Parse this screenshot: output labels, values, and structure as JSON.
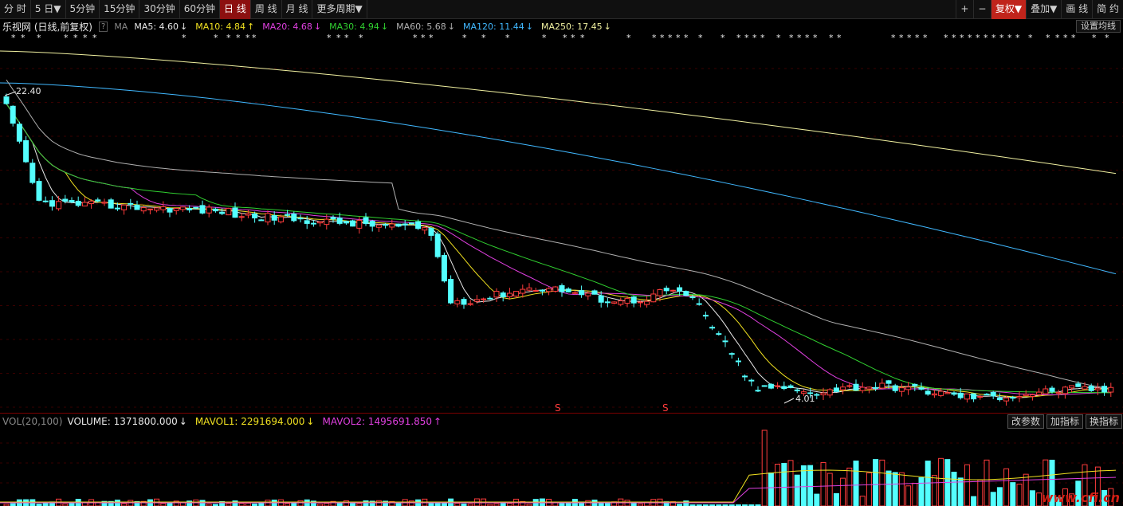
{
  "toolbar": {
    "periods": [
      {
        "label": "分 时",
        "active": false
      },
      {
        "label": "5 日▼",
        "active": false
      },
      {
        "label": "5分钟",
        "active": false
      },
      {
        "label": "15分钟",
        "active": false
      },
      {
        "label": "30分钟",
        "active": false
      },
      {
        "label": "60分钟",
        "active": false
      },
      {
        "label": "日 线",
        "active": true
      },
      {
        "label": "周 线",
        "active": false
      },
      {
        "label": "月 线",
        "active": false
      },
      {
        "label": "更多周期▼",
        "active": false
      }
    ],
    "right": [
      {
        "label": "+",
        "accent": false,
        "sq": true
      },
      {
        "label": "−",
        "accent": false,
        "sq": true
      },
      {
        "label": "复权▼",
        "accent": true,
        "sq": false
      },
      {
        "label": "叠加▼",
        "accent": false,
        "sq": false
      },
      {
        "label": "画 线",
        "accent": false,
        "sq": false
      },
      {
        "label": "简 约",
        "accent": false,
        "sq": false
      }
    ]
  },
  "legend": {
    "stock": "乐视网 (日线,前复权)",
    "question": "?",
    "ma_label": "MA",
    "items": [
      {
        "text": "MA5: 4.60",
        "arrow": "↓",
        "color": "#e8e8e8"
      },
      {
        "text": "MA10: 4.84",
        "arrow": "↑",
        "color": "#f0e020"
      },
      {
        "text": "MA20: 4.68",
        "arrow": "↓",
        "color": "#e040e0"
      },
      {
        "text": "MA30: 4.94",
        "arrow": "↓",
        "color": "#30d030"
      },
      {
        "text": "MA60: 5.68",
        "arrow": "↓",
        "color": "#b0b0b0"
      },
      {
        "text": "MA120: 11.44",
        "arrow": "↓",
        "color": "#40b8ff"
      },
      {
        "text": "MA250: 17.45",
        "arrow": "↓",
        "color": "#f0f0a0"
      }
    ],
    "set_ma": "设置均线"
  },
  "chart_annotations": {
    "high_label": "22.40",
    "low_label": "4.01",
    "s_marker": "S"
  },
  "volume": {
    "name": "VOL(20,100)",
    "items": [
      {
        "text": "VOLUME: 1371800.000",
        "arrow": "↓",
        "color": "#e8e8e8"
      },
      {
        "text": "MAVOL1: 2291694.000",
        "arrow": "↓",
        "color": "#f0e020"
      },
      {
        "text": "MAVOL2: 1495691.850",
        "arrow": "↑",
        "color": "#e040e0"
      }
    ],
    "buttons": [
      "改参数",
      "加指标",
      "换指标"
    ]
  },
  "colors": {
    "up": "#ff3c3c",
    "down": "#54ffff",
    "ma5": "#e8e8e8",
    "ma10": "#f0e020",
    "ma20": "#e040e0",
    "ma30": "#30d030",
    "ma60": "#b0b0b0",
    "ma120": "#40b8ff",
    "ma250": "#f0f0a0",
    "accent": "#c0241b"
  },
  "watermark": "www.cfi.cn"
}
